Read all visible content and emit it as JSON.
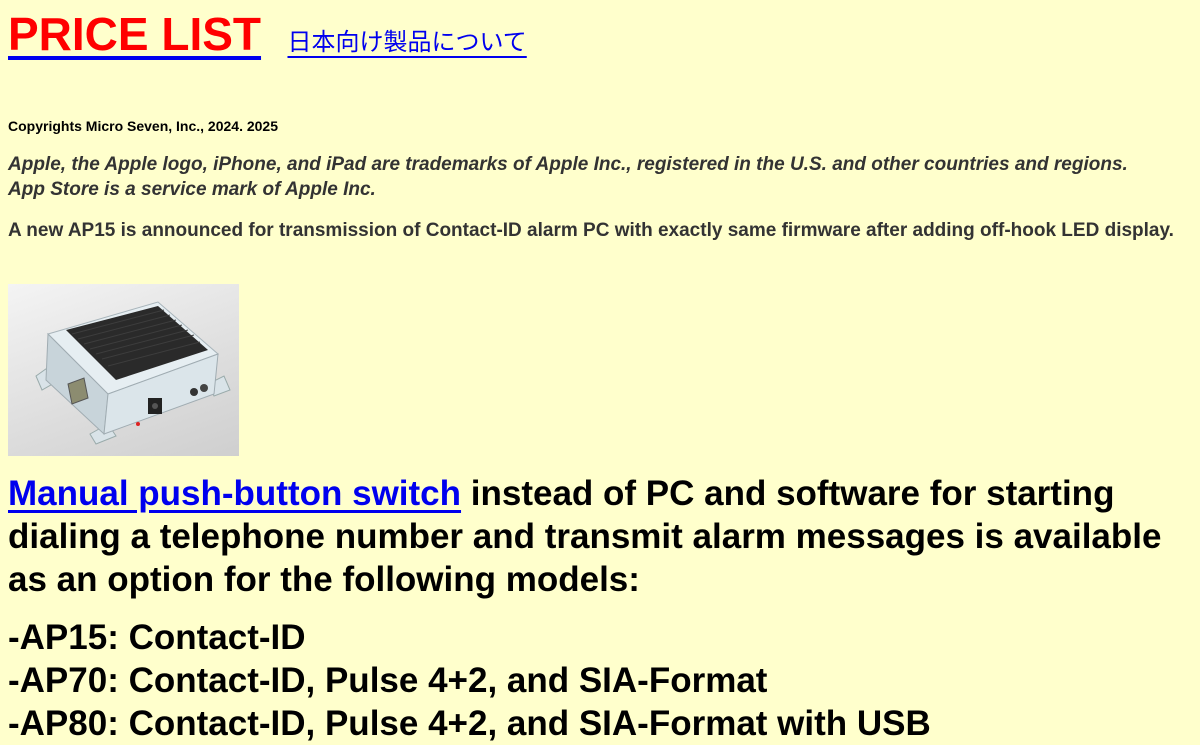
{
  "header": {
    "title": "PRICE LIST",
    "japanese_link": "日本向け製品について"
  },
  "copyright": "Copyrights Micro Seven, Inc., 2024. 2025",
  "trademark_notice": "Apple, the Apple logo, iPhone, and iPad are trademarks of Apple Inc., registered in the U.S. and other countries and regions. App Store is a service mark of Apple Inc.",
  "announcement": " A new AP15 is announced for transmission of Contact-ID alarm PC with exactly same firmware after adding off-hook LED display.",
  "product_image": {
    "icon": "ap15-device-photo"
  },
  "headline": {
    "link_text": "Manual push-button switch",
    "rest": " instead of PC and software for starting dialing a telephone number and transmit alarm messages is available as an option for the following models:"
  },
  "models": [
    "-AP15: Contact-ID",
    "-AP70: Contact-ID, Pulse 4+2, and SIA-Format",
    "-AP80: Contact-ID, Pulse 4+2, and SIA-Format with USB"
  ],
  "colors": {
    "background": "#ffffcc",
    "title": "#ff0000",
    "link": "#0000ee"
  }
}
